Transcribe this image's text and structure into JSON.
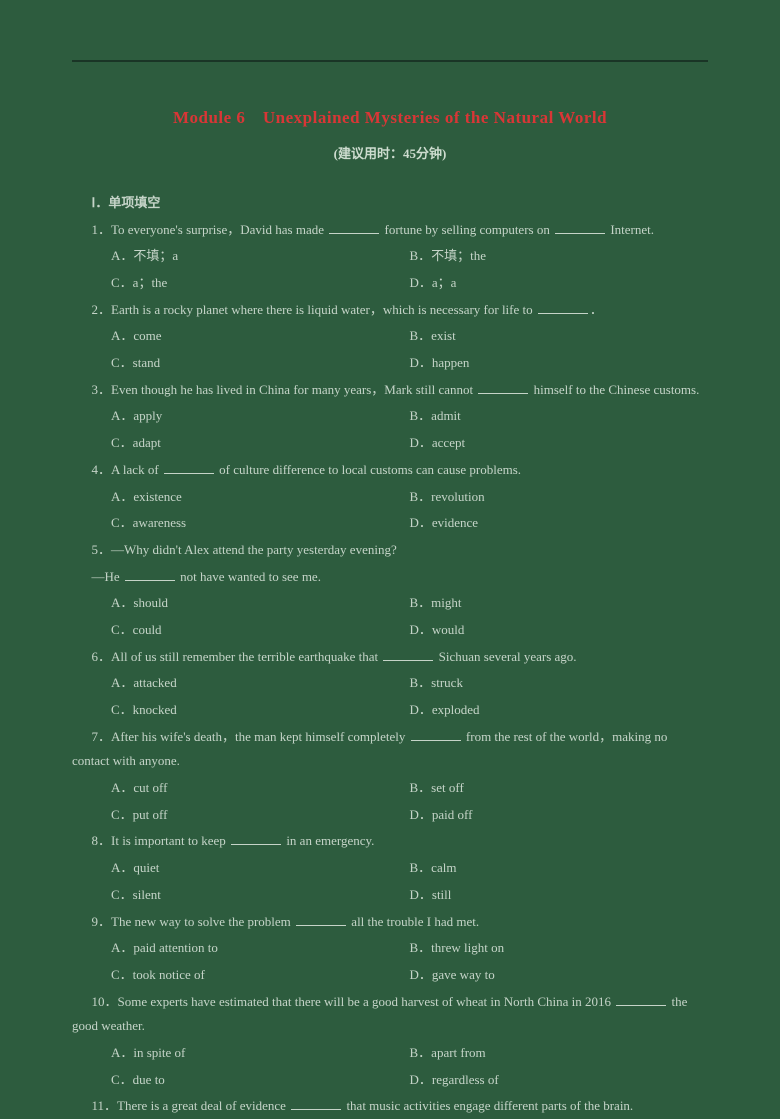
{
  "title": "Module 6　Unexplained Mysteries of the Natural World",
  "subtitle": "(建议用时：45分钟)",
  "section1": "Ⅰ．单项填空",
  "q1": {
    "stem_a": "1．To everyone's surprise，David has made ",
    "stem_b": " fortune by selling computers on ",
    "stem_c": " Internet.",
    "A": "A．不填；a",
    "B": "B．不填；the",
    "C": "C．a；the",
    "D": "D．a；a"
  },
  "q2": {
    "stem_a": "2．Earth is a rocky planet where there is liquid water，which is necessary for life to ",
    "stem_b": "．",
    "A": "A．come",
    "B": "B．exist",
    "C": "C．stand",
    "D": "D．happen"
  },
  "q3": {
    "stem_a": "3．Even though he has lived in China for many years，Mark still cannot ",
    "stem_b": " himself to the Chinese customs.",
    "A": "A．apply",
    "B": "B．admit",
    "C": "C．adapt",
    "D": "D．accept"
  },
  "q4": {
    "stem_a": "4．A lack of ",
    "stem_b": " of culture difference to local customs can cause problems.",
    "A": "A．existence",
    "B": "B．revolution",
    "C": "C．awareness",
    "D": "D．evidence"
  },
  "q5": {
    "stem1": "5．—Why didn't Alex attend the party yesterday evening?",
    "stem2_a": "—He ",
    "stem2_b": " not have wanted to see me.",
    "A": "A．should",
    "B": "B．might",
    "C": "C．could",
    "D": "D．would"
  },
  "q6": {
    "stem_a": "6．All of us still remember the terrible earthquake that ",
    "stem_b": " Sichuan several years ago.",
    "A": "A．attacked",
    "B": "B．struck",
    "C": "C．knocked",
    "D": "D．exploded"
  },
  "q7": {
    "stem_a": "7．After his wife's death，the man kept himself completely ",
    "stem_b": " from the rest of the world，making no contact with anyone.",
    "A": "A．cut off",
    "B": "B．set off",
    "C": "C．put off",
    "D": "D．paid off"
  },
  "q8": {
    "stem_a": "8．It is important to keep ",
    "stem_b": " in an emergency.",
    "A": "A．quiet",
    "B": "B．calm",
    "C": "C．silent",
    "D": "D．still"
  },
  "q9": {
    "stem_a": "9．The new way to solve the problem ",
    "stem_b": " all the trouble I had met.",
    "A": "A．paid attention to",
    "B": "B．threw light on",
    "C": "C．took notice of",
    "D": "D．gave way to"
  },
  "q10": {
    "stem_a": "10．Some experts have estimated that there will be a good harvest of wheat in North China in 2016 ",
    "stem_b": " the good weather.",
    "A": "A．in spite of",
    "B": "B．apart from",
    "C": "C．due to",
    "D": "D．regardless of"
  },
  "q11": {
    "stem_a": "11．There is a great deal of evidence ",
    "stem_b": " that music activities engage different parts of the brain."
  }
}
